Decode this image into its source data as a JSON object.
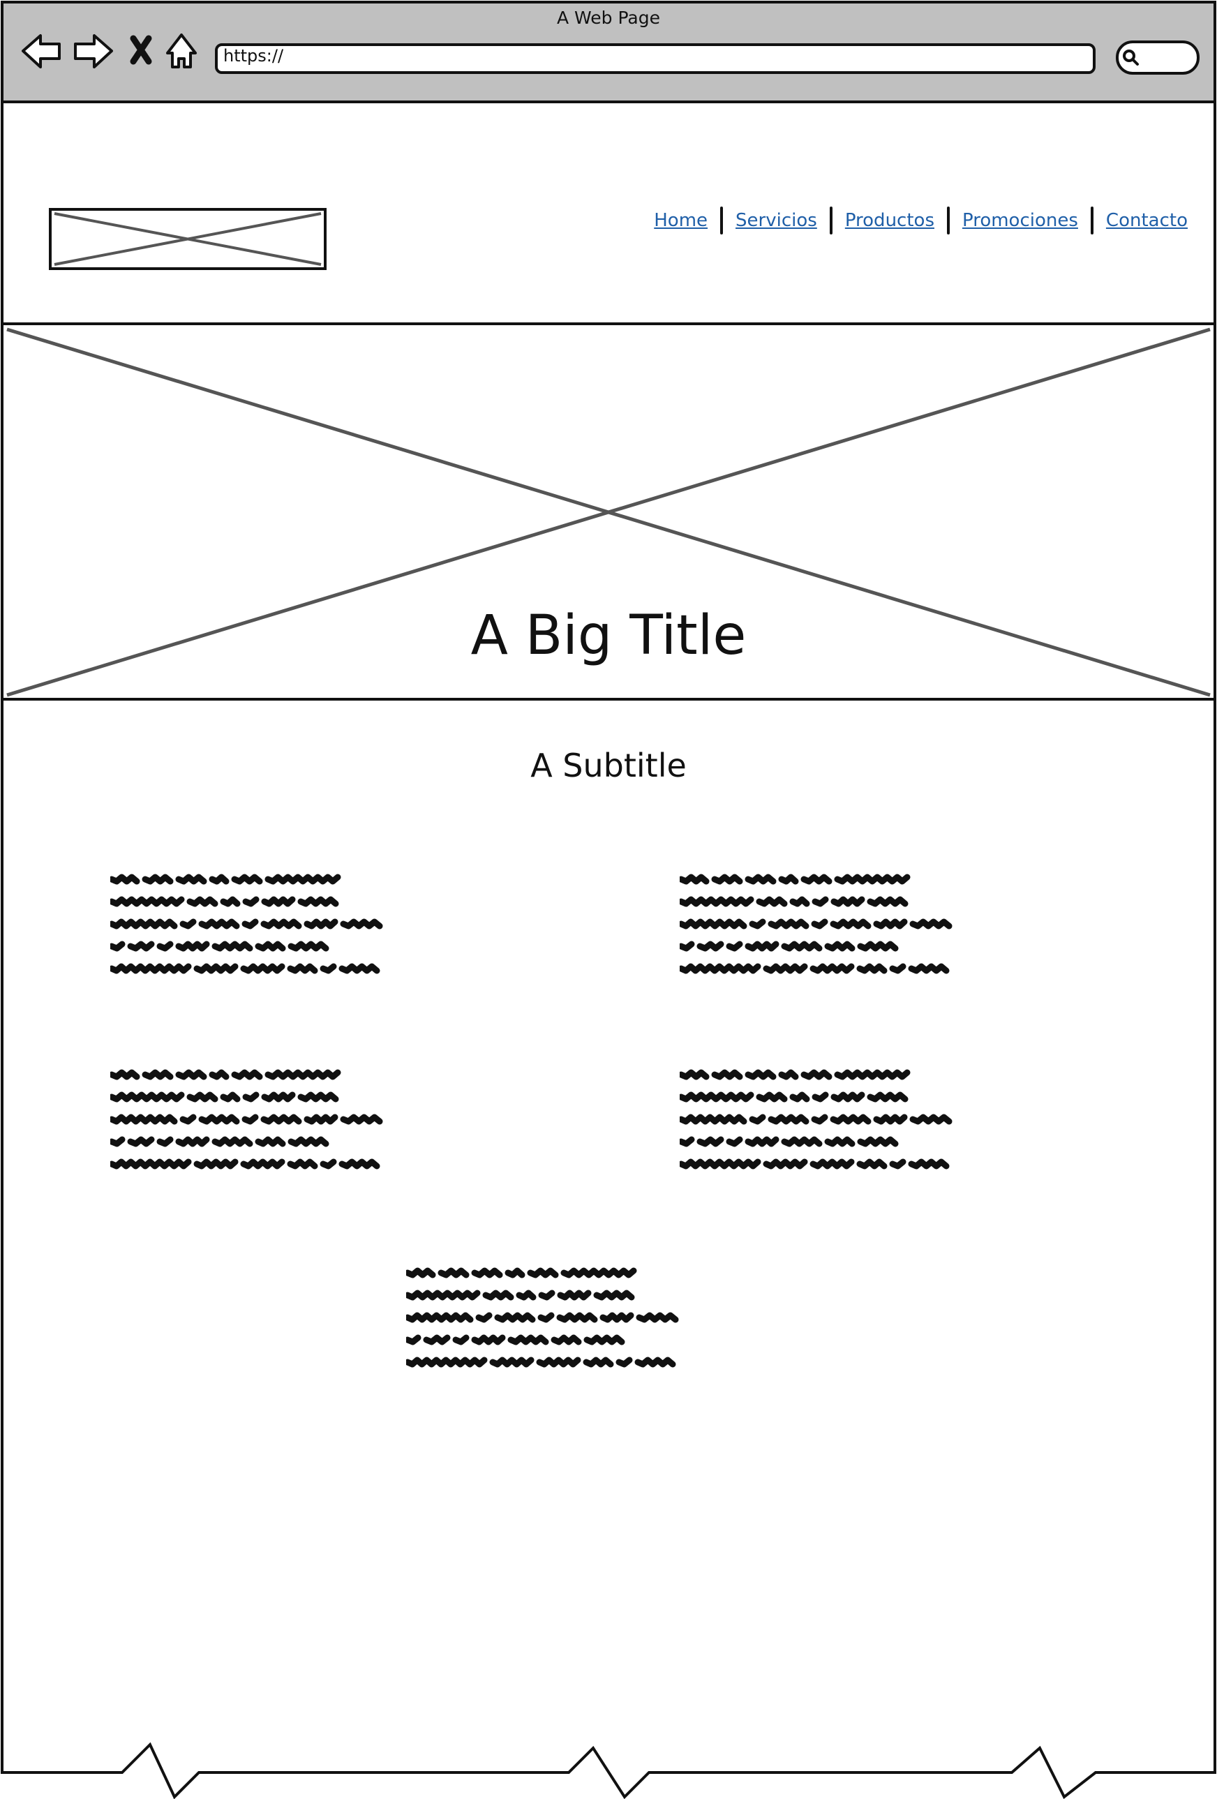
{
  "browser": {
    "title": "A Web Page",
    "url": "https://",
    "icons": [
      "back-arrow-icon",
      "forward-arrow-icon",
      "close-icon",
      "home-icon",
      "search-icon"
    ]
  },
  "header": {
    "logo": "image-placeholder",
    "nav": [
      {
        "label": "Home"
      },
      {
        "label": "Servicios"
      },
      {
        "label": "Productos"
      },
      {
        "label": "Promociones"
      },
      {
        "label": "Contacto"
      }
    ],
    "link_color": "#1f5fa8"
  },
  "hero": {
    "image": "image-placeholder",
    "title": "A Big Title"
  },
  "content": {
    "subtitle": "A Subtitle",
    "text_blocks": [
      "text-placeholder",
      "text-placeholder",
      "text-placeholder",
      "text-placeholder",
      "text-placeholder"
    ]
  },
  "colors": {
    "toolbar_bg": "#c0c0c0",
    "outline": "#111111",
    "placeholder_x": "#555555"
  }
}
